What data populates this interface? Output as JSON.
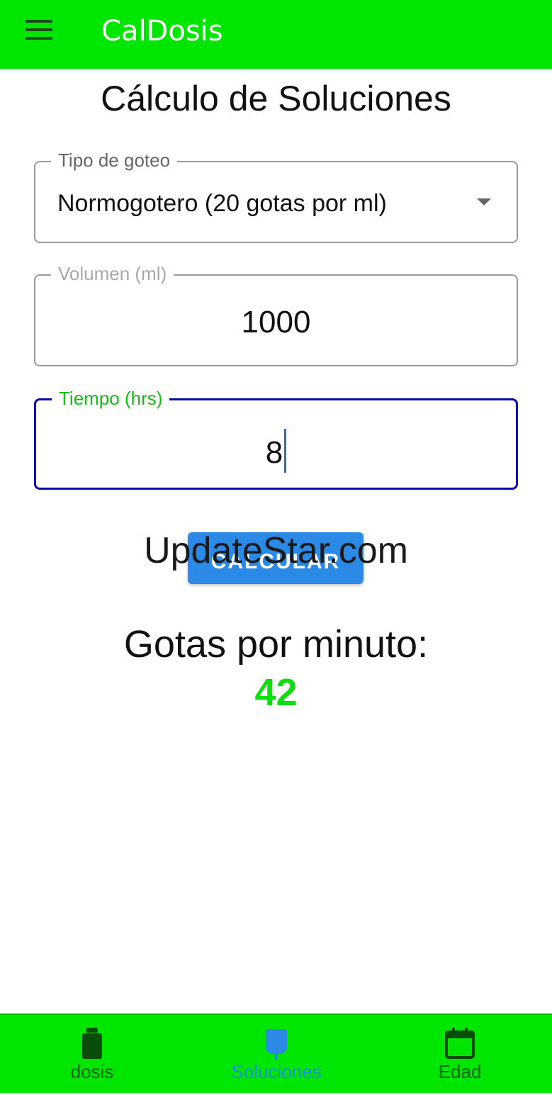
{
  "app": {
    "title": "CalDosis",
    "brand_color": "#00e600"
  },
  "page": {
    "title": "Cálculo de Soluciones"
  },
  "form": {
    "drip_type": {
      "label": "Tipo de goteo",
      "value": "Normogotero (20 gotas por ml)"
    },
    "volume": {
      "label": "Volumen (ml)",
      "value": "1000"
    },
    "time": {
      "label": "Tiempo (hrs)",
      "value": "8"
    }
  },
  "actions": {
    "calculate_label": "CALCULAR"
  },
  "watermark": "UpdateStar.com",
  "result": {
    "label": "Gotas por minuto:",
    "value": "42"
  },
  "bottom_nav": {
    "items": [
      {
        "label": "dosis",
        "icon": "bottle-icon",
        "active": false
      },
      {
        "label": "Soluciones",
        "icon": "iv-bag-icon",
        "active": true
      },
      {
        "label": "Edad",
        "icon": "calendar-icon",
        "active": false
      }
    ]
  }
}
